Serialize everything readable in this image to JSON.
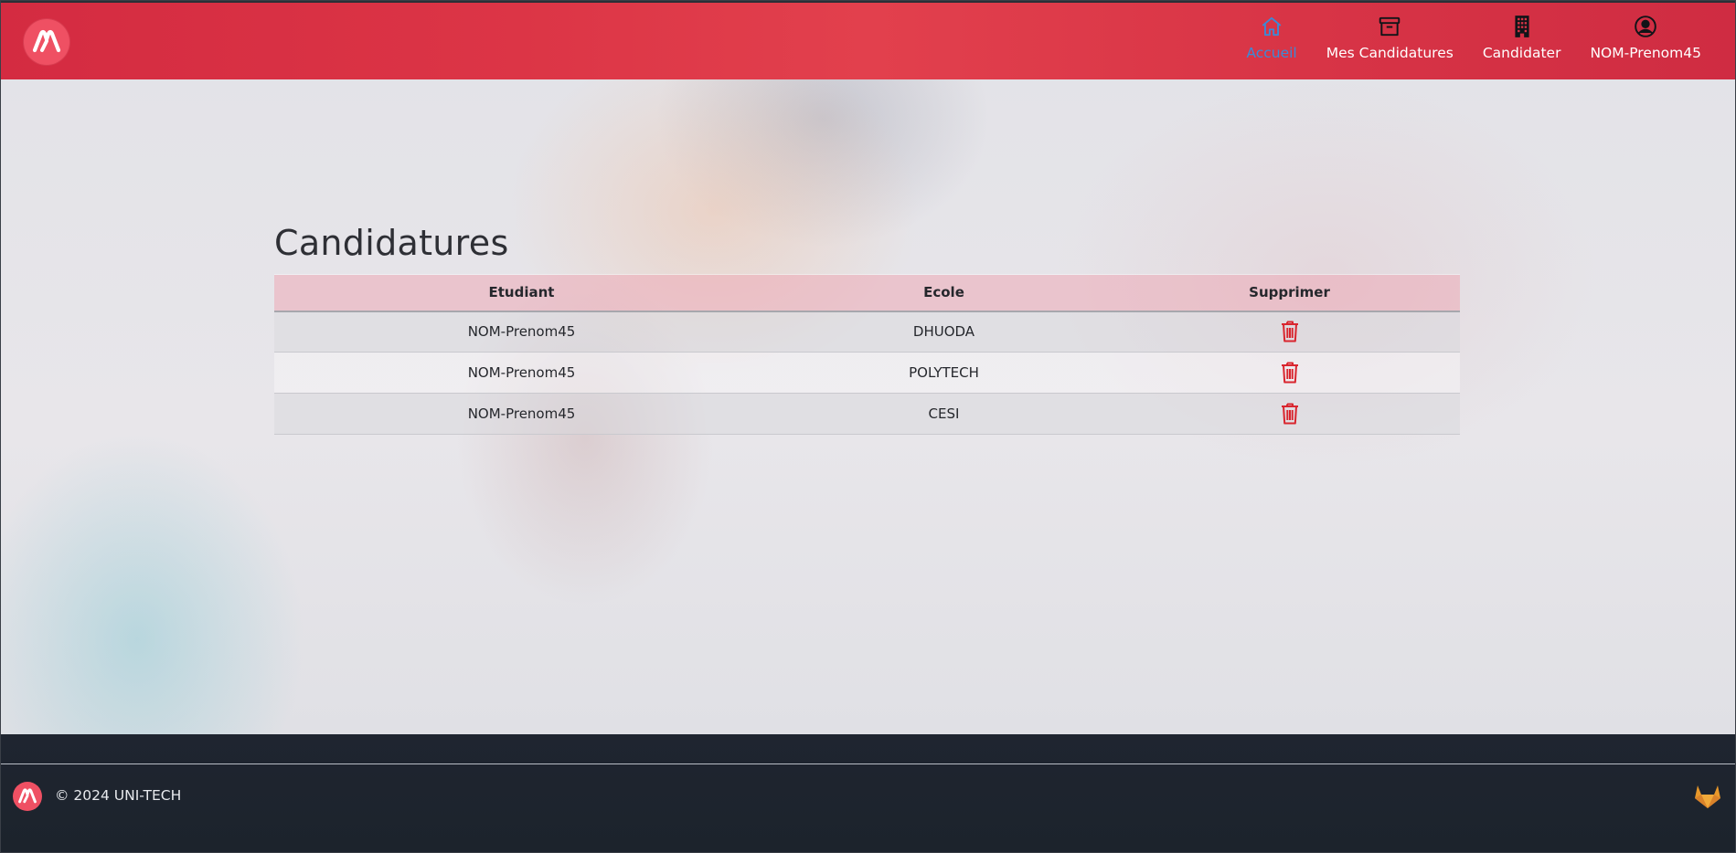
{
  "header": {
    "logo_icon": "uni-tech-logo-icon",
    "nav": [
      {
        "label": "Accueil",
        "icon": "home-icon",
        "active": true
      },
      {
        "label": "Mes Candidatures",
        "icon": "archive-box-icon",
        "active": false
      },
      {
        "label": "Candidater",
        "icon": "building-icon",
        "active": false
      },
      {
        "label": "NOM-Prenom45",
        "icon": "user-circle-icon",
        "active": false
      }
    ]
  },
  "main": {
    "title": "Candidatures",
    "table": {
      "headers": [
        "Etudiant",
        "Ecole",
        "Supprimer"
      ],
      "rows": [
        {
          "etudiant": "NOM-Prenom45",
          "ecole": "DHUODA",
          "action_icon": "trash-icon"
        },
        {
          "etudiant": "NOM-Prenom45",
          "ecole": "POLYTECH",
          "action_icon": "trash-icon"
        },
        {
          "etudiant": "NOM-Prenom45",
          "ecole": "CESI",
          "action_icon": "trash-icon"
        }
      ]
    }
  },
  "footer": {
    "copyright": "© 2024 UNI-TECH",
    "gitlab_icon": "gitlab-icon"
  },
  "colors": {
    "header_red": "#dc3546",
    "active_link": "#3a8bd8",
    "trash_red": "#d9262f",
    "footer_bg": "#1f2530",
    "gitlab_orange": "#e8982a"
  }
}
